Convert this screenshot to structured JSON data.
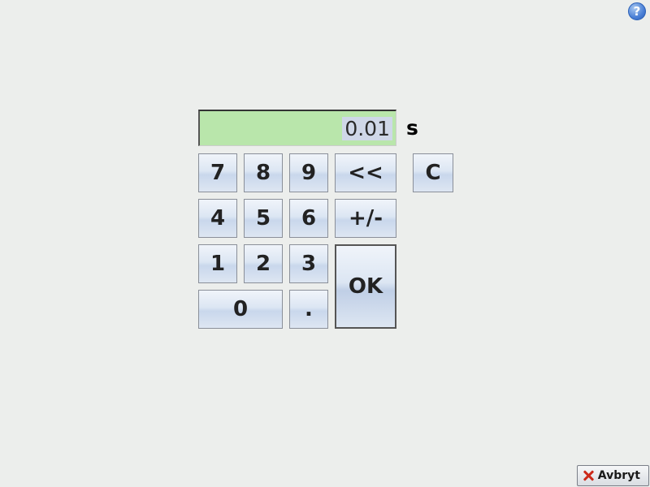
{
  "help": {
    "glyph": "?"
  },
  "display": {
    "value": "0.01",
    "unit": "s"
  },
  "keys": {
    "k7": "7",
    "k8": "8",
    "k9": "9",
    "back": "<<",
    "clear": "C",
    "k4": "4",
    "k5": "5",
    "k6": "6",
    "sign": "+/-",
    "k1": "1",
    "k2": "2",
    "k3": "3",
    "k0": "0",
    "dot": ".",
    "ok": "OK"
  },
  "cancel": {
    "label": "Avbryt"
  }
}
